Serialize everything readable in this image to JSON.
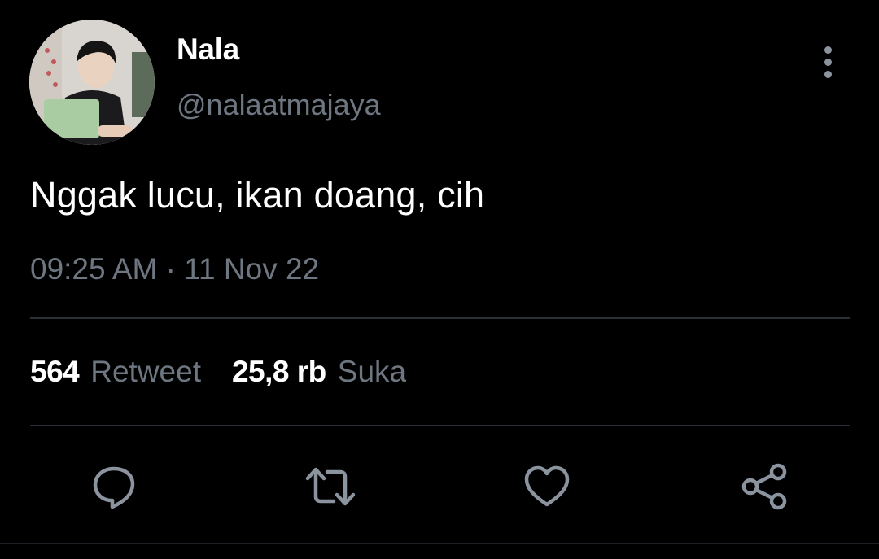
{
  "user": {
    "display_name": "Nala",
    "handle": "@nalaatmajaya",
    "avatar_icon": "profile-photo"
  },
  "tweet": {
    "text": "Nggak lucu, ikan doang, cih",
    "timestamp": "09:25 AM · 11 Nov 22"
  },
  "stats": {
    "retweets": {
      "count": "564",
      "label": "Retweet"
    },
    "likes": {
      "count": "25,8 rb",
      "label": "Suka"
    }
  },
  "actions": [
    {
      "name": "reply",
      "icon": "reply-icon"
    },
    {
      "name": "retweet",
      "icon": "retweet-icon"
    },
    {
      "name": "like",
      "icon": "heart-icon"
    },
    {
      "name": "share",
      "icon": "share-icon"
    }
  ],
  "colors": {
    "background": "#000000",
    "primary_text": "#ffffff",
    "secondary_text": "#6e7781",
    "divider": "#2a2f35",
    "icon": "#8b949e"
  }
}
